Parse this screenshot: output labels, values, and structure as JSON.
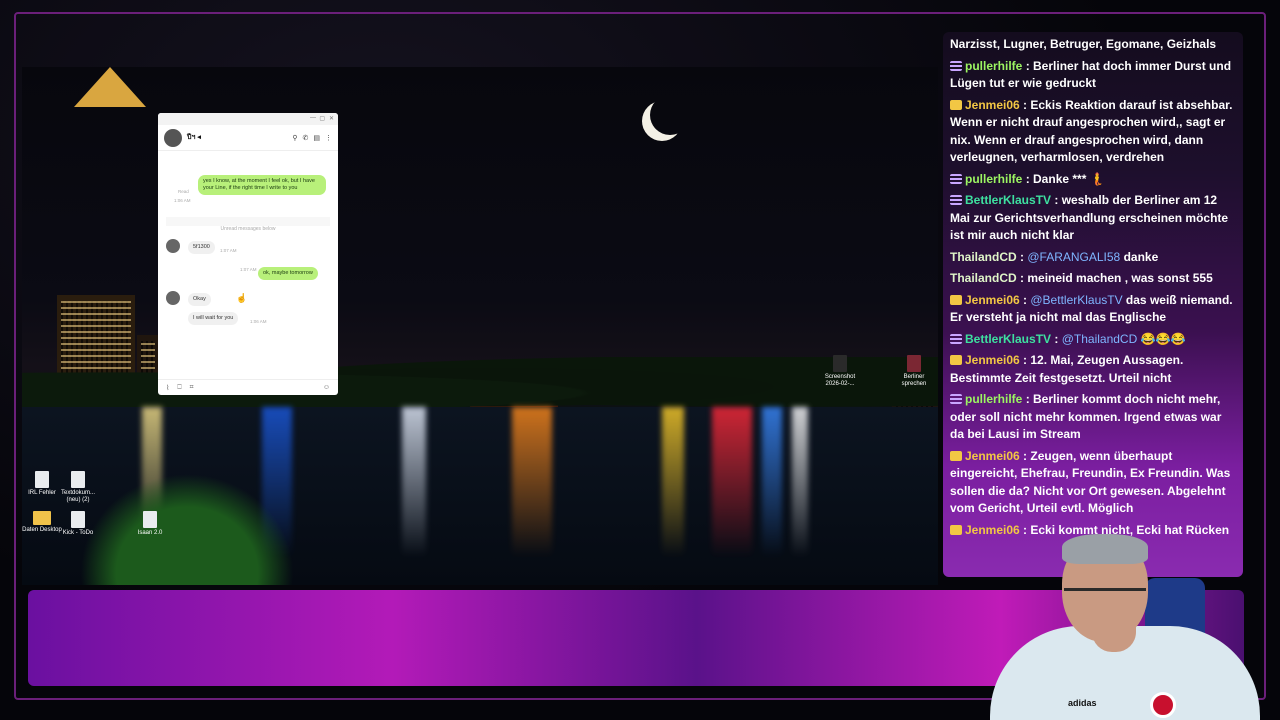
{
  "desktop": {
    "icons": [
      {
        "label": "IRL Fehler",
        "kind": "doc"
      },
      {
        "label": "Textdokum... (neu) (2)",
        "kind": "doc"
      },
      {
        "label": "Daten Desktop",
        "kind": "folder"
      },
      {
        "label": "Kick - ToDo",
        "kind": "doc"
      },
      {
        "label": "Isaan 2.0",
        "kind": "doc"
      },
      {
        "label": "Screenshot 2026-02-...",
        "kind": "img"
      },
      {
        "label": "Berliner sprechen",
        "kind": "img"
      }
    ]
  },
  "messenger": {
    "contact_name": "Ѕ̴",
    "contact_display": "ปีฯ ◂",
    "messages": [
      {
        "dir": "out",
        "text": "yes I know, at the moment I feel ok, but I have your Line, if the right time I write to you",
        "time": "1:06 AM",
        "status": "Read"
      },
      {
        "divider": "Unread messages below"
      },
      {
        "dir": "in",
        "text": "5f1300",
        "time": "1:07 AM"
      },
      {
        "dir": "out",
        "text": "ok, maybe tomorrow",
        "time": "1:07 AM",
        "status": "Read"
      },
      {
        "dir": "in",
        "text": "Okay",
        "time": ""
      },
      {
        "dir": "in",
        "text": "I will wait for you",
        "time": "1:06 AM"
      }
    ]
  },
  "chat": {
    "messages": [
      {
        "badge": "none",
        "user": "",
        "user_color": "plain",
        "text": "Narzisst, Lugner, Betruger, Egomane, Geizhals"
      },
      {
        "badge": "lines",
        "user": "pullerhilfe",
        "user_color": "green",
        "text": ": Berliner hat doch immer Durst und Lügen tut er wie gedruckt"
      },
      {
        "badge": "crown",
        "user": "Jenmei06",
        "user_color": "gold",
        "text": ": Eckis Reaktion darauf ist absehbar. Wenn er nicht drauf angesprochen wird,, sagt er nix. Wenn er drauf angesprochen wird, dann verleugnen, verharmlosen, verdrehen"
      },
      {
        "badge": "lines",
        "user": "pullerhilfe",
        "user_color": "green",
        "text": ": Danke *** 🧜"
      },
      {
        "badge": "lines",
        "user": "BettlerKlausTV",
        "user_color": "teal",
        "text": ": weshalb der Berliner am 12 Mai zur Gerichtsverhandlung erscheinen möchte ist mir auch nicht klar"
      },
      {
        "badge": "none",
        "user": "ThailandCD",
        "user_color": "plain",
        "mention": "@FARANGALI58",
        "text": " danke"
      },
      {
        "badge": "none",
        "user": "ThailandCD",
        "user_color": "plain",
        "text": ": meineid machen , was sonst 555"
      },
      {
        "badge": "crown",
        "user": "Jenmei06",
        "user_color": "gold",
        "mention": "@BettlerKlausTV",
        "text": " das weiß niemand. Er versteht ja nicht mal das Englische"
      },
      {
        "badge": "lines",
        "user": "BettlerKlausTV",
        "user_color": "teal",
        "mention": "@ThailandCD",
        "text": " 😂😂😂"
      },
      {
        "badge": "crown",
        "user": "Jenmei06",
        "user_color": "gold",
        "text": ": 12. Mai, Zeugen Aussagen. Bestimmte Zeit festgesetzt. Urteil nicht"
      },
      {
        "badge": "lines",
        "user": "pullerhilfe",
        "user_color": "green",
        "text": ": Berliner kommt doch nicht mehr, oder soll nicht mehr kommen. Irgend etwas war da bei Lausi im Stream"
      },
      {
        "badge": "crown",
        "user": "Jenmei06",
        "user_color": "gold",
        "text": ": Zeugen, wenn überhaupt eingereicht, Ehefrau, Freundin, Ex Freundin. Was sollen die da? Nicht vor Ort gewesen. Abgelehnt vom Gericht, Urteil evtl. Möglich"
      },
      {
        "badge": "crown",
        "user": "Jenmei06",
        "user_color": "gold",
        "text": ": Ecki kommt nicht, Ecki hat Rücken"
      }
    ]
  },
  "webcam": {
    "shirt_logo": "adidas"
  }
}
